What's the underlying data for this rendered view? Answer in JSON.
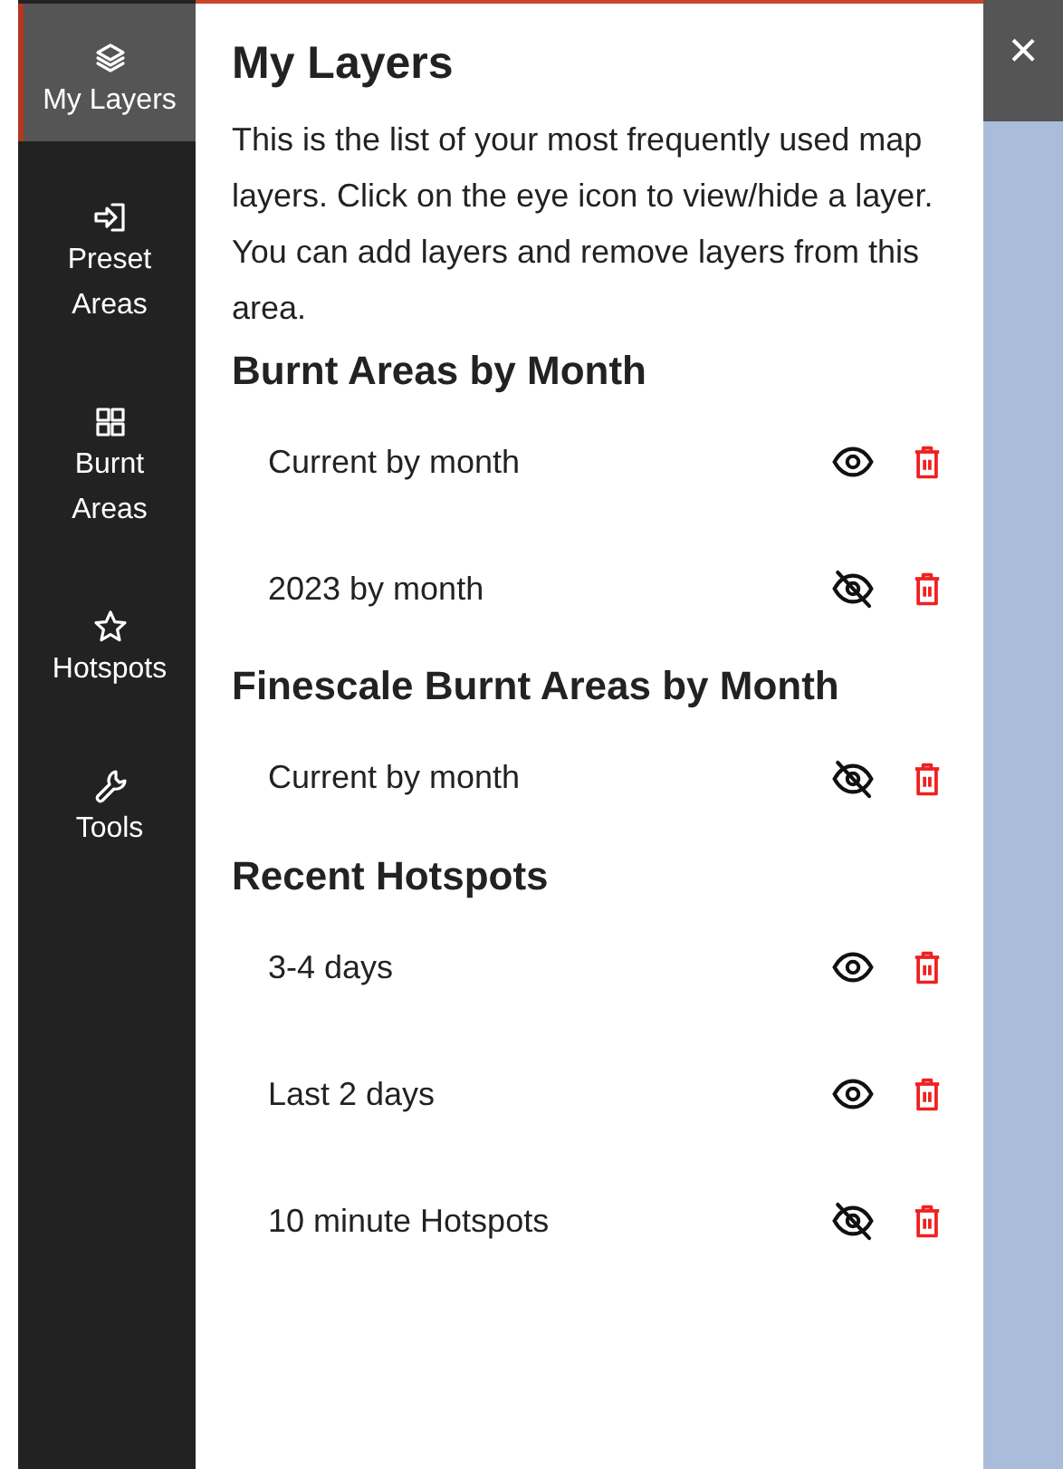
{
  "sidebar": {
    "items": [
      {
        "label": "My Layers",
        "selected": true
      },
      {
        "label": "Preset\nAreas",
        "selected": false
      },
      {
        "label": "Burnt\nAreas",
        "selected": false
      },
      {
        "label": "Hotspots",
        "selected": false
      },
      {
        "label": "Tools",
        "selected": false
      }
    ]
  },
  "panel": {
    "title": "My Layers",
    "description": "This is the list of your most frequently used map layers. Click on the eye icon to view/hide a layer. You can add layers and remove layers from this area.",
    "sections": [
      {
        "title": "Burnt Areas by Month",
        "layers": [
          {
            "name": "Current by month",
            "visible": true
          },
          {
            "name": "2023 by month",
            "visible": false
          }
        ]
      },
      {
        "title": "Finescale Burnt Areas by Month",
        "layers": [
          {
            "name": "Current by month",
            "visible": false
          }
        ]
      },
      {
        "title": "Recent Hotspots",
        "layers": [
          {
            "name": "3-4 days",
            "visible": true
          },
          {
            "name": "Last 2 days",
            "visible": true
          },
          {
            "name": "10 minute Hotspots",
            "visible": false
          }
        ]
      }
    ]
  },
  "close_button": "×"
}
